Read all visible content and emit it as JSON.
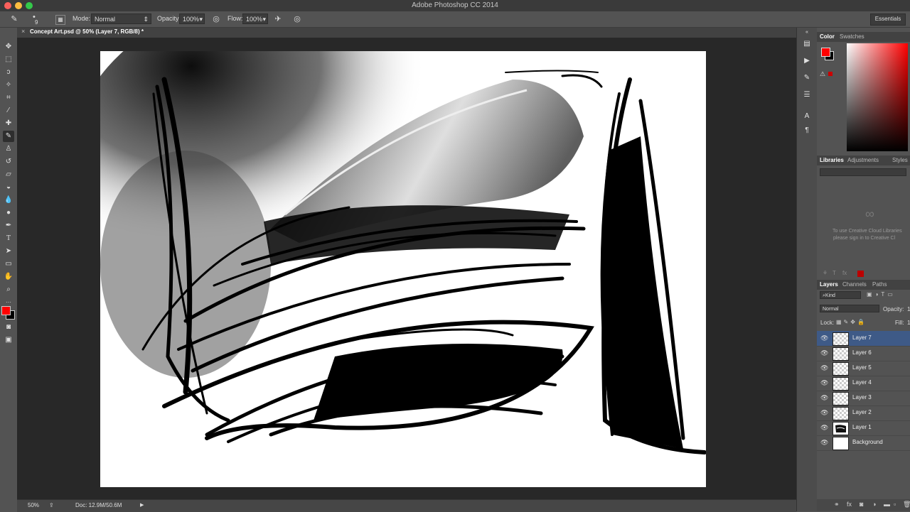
{
  "app": {
    "title": "Adobe Photoshop CC 2014"
  },
  "options_bar": {
    "brush_size": "9",
    "mode_label": "Mode:",
    "mode_value": "Normal",
    "opacity_label": "Opacity:",
    "opacity_value": "100%",
    "flow_label": "Flow:",
    "flow_value": "100%",
    "workspace": "Essentials"
  },
  "document": {
    "tab_label": "Concept Art.psd @ 50% (Layer 7, RGB/8) *",
    "close_glyph": "×"
  },
  "status_bar": {
    "zoom": "50%",
    "doc_info": "Doc: 12.9M/50.6M"
  },
  "colors": {
    "foreground": "#ff0000",
    "background": "#000000",
    "selection": "#3e5a87"
  },
  "tools": [
    "move-tool-icon",
    "marquee-tool-icon",
    "lasso-tool-icon",
    "quick-select-tool-icon",
    "crop-tool-icon",
    "eyedropper-tool-icon",
    "healing-brush-tool-icon",
    "brush-tool-icon",
    "clone-stamp-tool-icon",
    "history-brush-tool-icon",
    "eraser-tool-icon",
    "paint-bucket-tool-icon",
    "blur-tool-icon",
    "dodge-tool-icon",
    "pen-tool-icon",
    "type-tool-icon",
    "path-select-tool-icon",
    "shape-tool-icon",
    "hand-tool-icon",
    "zoom-tool-icon"
  ],
  "color_panel": {
    "tabs": [
      "Color",
      "Swatches"
    ],
    "active_tab": "Color",
    "hue": "#ff0000"
  },
  "libraries_panel": {
    "tabs": [
      "Libraries",
      "Adjustments",
      "Styles"
    ],
    "message_line1": "To use Creative Cloud Libraries",
    "message_line2": "please sign in to Creative Cl"
  },
  "layers_panel": {
    "tabs": [
      "Layers",
      "Channels",
      "Paths"
    ],
    "filter_kind": "Kind",
    "blend_mode": "Normal",
    "opacity_label": "Opacity:",
    "opacity_value": "1",
    "lock_label": "Lock:",
    "fill_label": "Fill:",
    "fill_value": "1",
    "layers": [
      {
        "name": "Layer 7",
        "selected": true,
        "visible": true,
        "thumb": "transparent"
      },
      {
        "name": "Layer 6",
        "selected": false,
        "visible": true,
        "thumb": "transparent"
      },
      {
        "name": "Layer 5",
        "selected": false,
        "visible": true,
        "thumb": "transparent"
      },
      {
        "name": "Layer 4",
        "selected": false,
        "visible": true,
        "thumb": "transparent"
      },
      {
        "name": "Layer 3",
        "selected": false,
        "visible": true,
        "thumb": "transparent"
      },
      {
        "name": "Layer 2",
        "selected": false,
        "visible": true,
        "thumb": "transparent"
      },
      {
        "name": "Layer 1",
        "selected": false,
        "visible": true,
        "thumb": "art"
      },
      {
        "name": "Background",
        "selected": false,
        "visible": true,
        "thumb": "white"
      }
    ]
  }
}
